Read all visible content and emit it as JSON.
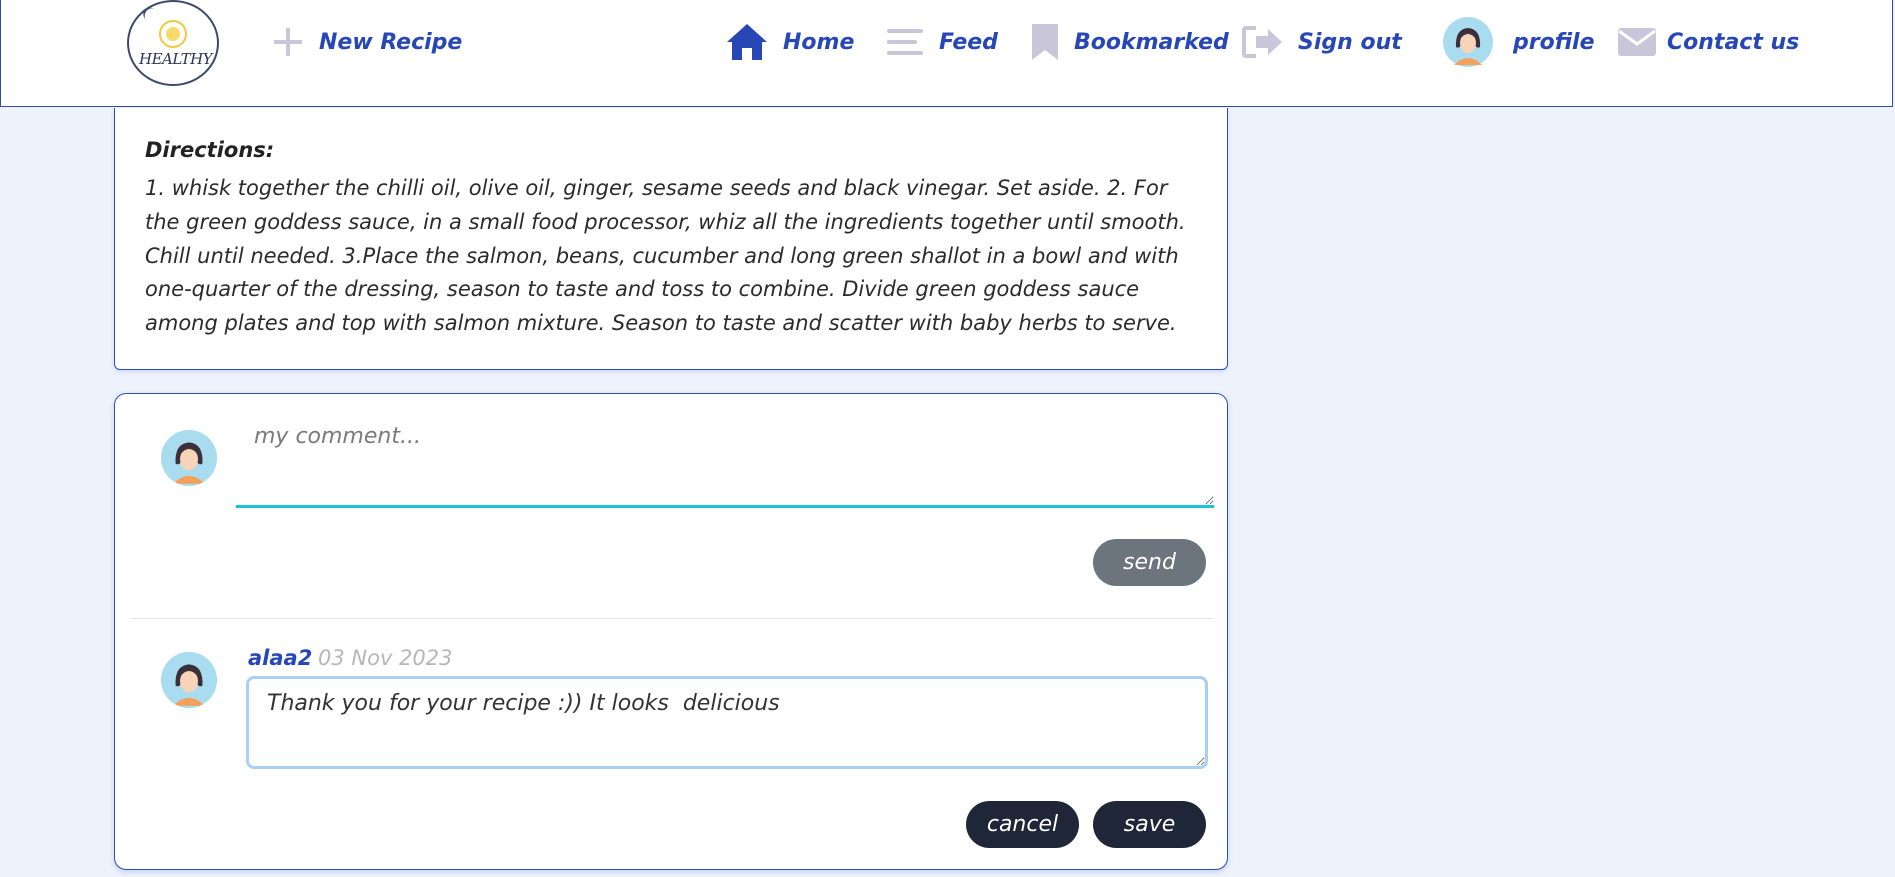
{
  "navbar": {
    "logo_text": "HEALTHY",
    "new_recipe": "New Recipe",
    "home": "Home",
    "feed": "Feed",
    "bookmarked": "Bookmarked",
    "sign_out": "Sign out",
    "profile": "profile",
    "contact": "Contact us"
  },
  "recipe": {
    "directions_title": "Directions:",
    "directions_text": "1. whisk together the chilli oil, olive oil, ginger, sesame seeds and black vinegar. Set aside. 2. For the green goddess sauce, in a small food processor, whiz all the ingredients together until smooth. Chill until needed. 3.Place the salmon, beans, cucumber and long green shallot in a bowl and with one-quarter of the dressing, season to taste and toss to combine. Divide green goddess sauce among plates and top with salmon mixture. Season to taste and scatter with baby herbs to serve."
  },
  "comment_form": {
    "placeholder": "my comment...",
    "send_label": "send"
  },
  "comments": [
    {
      "author": "alaa2",
      "date": "03 Nov 2023",
      "text": "Thank you for your recipe :)) It looks  delicious",
      "cancel_label": "cancel",
      "save_label": "save"
    }
  ],
  "colors": {
    "brand_blue": "#2647b5",
    "accent_cyan": "#17c4dc",
    "icon_gray": "#c9c6da",
    "dark_button": "#1f2637",
    "send_button": "#6c757d"
  },
  "icons": {
    "new_recipe": "plus-icon",
    "home": "house-icon",
    "feed": "menu-icon",
    "bookmarked": "bookmark-icon",
    "sign_out": "sign-out-icon",
    "profile": "avatar",
    "contact": "envelope-icon"
  }
}
